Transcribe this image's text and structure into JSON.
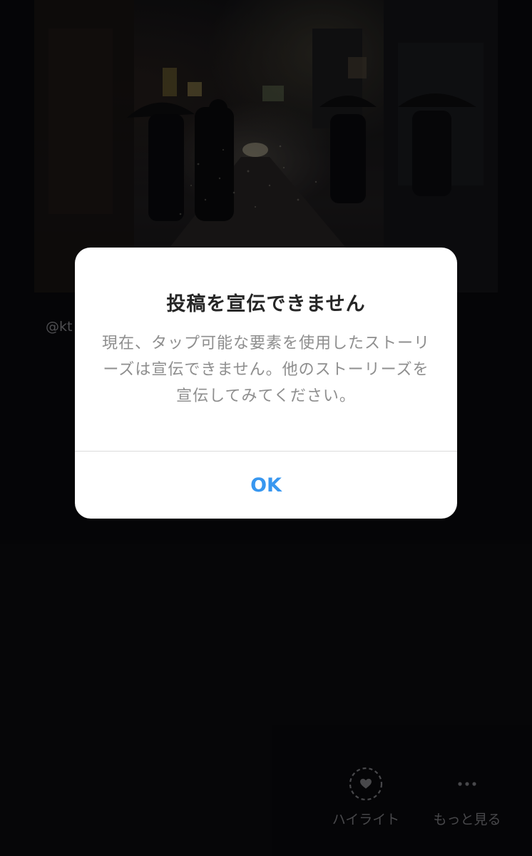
{
  "story": {
    "username": "@kt"
  },
  "dialog": {
    "title": "投稿を宣伝できません",
    "message": "現在、タップ可能な要素を使用したストーリーズは宣伝できません。他のストーリーズを宣伝してみてください。",
    "ok_label": "OK"
  },
  "bottom_bar": {
    "highlight_label": "ハイライト",
    "more_label": "もっと見る"
  },
  "icons": {
    "highlight": "heart-circle-icon",
    "more": "more-dots-icon"
  },
  "colors": {
    "accent": "#3897f0",
    "dialog_bg": "#ffffff",
    "title": "#262626",
    "message": "#8e8e8e",
    "background": "#09090c"
  }
}
